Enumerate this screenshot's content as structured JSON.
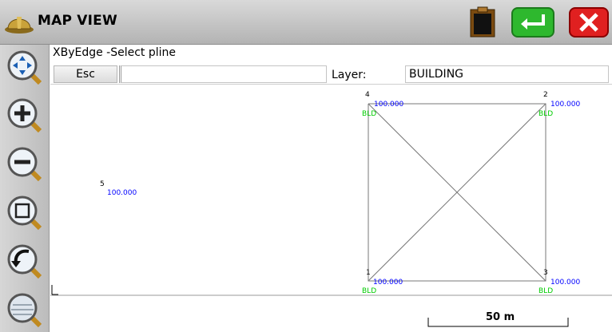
{
  "window": {
    "title": "MAP VIEW"
  },
  "command": {
    "prompt": "XByEdge -Select pline",
    "esc_label": "Esc",
    "input_value": "",
    "layer_label": "Layer:",
    "layer_value": "BUILDING"
  },
  "map": {
    "points": [
      {
        "id": "4",
        "elevation": "100.000",
        "code": "BLD"
      },
      {
        "id": "2",
        "elevation": "100.000",
        "code": "BLD"
      },
      {
        "id": "5",
        "elevation": "100.000"
      },
      {
        "id": "1",
        "elevation": "100.000",
        "code": "BLD"
      },
      {
        "id": "3",
        "elevation": "100.000",
        "code": "BLD"
      }
    ],
    "scale_label": "50 m"
  },
  "icons": {
    "app": "hardhat-icon",
    "clipboard": "clipboard-icon",
    "enter": "enter-icon",
    "close": "close-icon",
    "tools": [
      "pan-zoom-icon",
      "zoom-in-icon",
      "zoom-out-icon",
      "zoom-window-icon",
      "zoom-previous-icon",
      "zoom-extents-icon"
    ]
  },
  "colors": {
    "elevation_text": "#0000ff",
    "code_text": "#00cc00",
    "close_button": "#e02020",
    "enter_button": "#2eb82e"
  }
}
